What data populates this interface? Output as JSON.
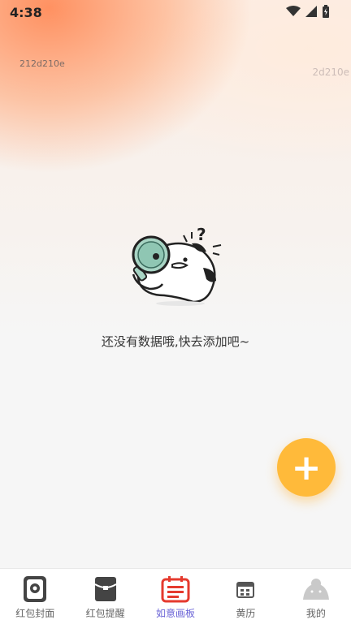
{
  "status_bar": {
    "time": "4:38",
    "icons": [
      "wifi-icon",
      "signal-icon",
      "battery-icon"
    ]
  },
  "watermarks": {
    "left": "212d210e",
    "right": "2d210e"
  },
  "empty_state": {
    "message": "还没有数据哦,快去添加吧~",
    "illustration": "magnifier-character"
  },
  "fab": {
    "label": "+",
    "color": "#ffba3a"
  },
  "tabbar": {
    "active_color": "#6a63d6",
    "items": [
      {
        "label": "红包封面",
        "icon": "cover-icon"
      },
      {
        "label": "红包提醒",
        "icon": "envelope-icon"
      },
      {
        "label": "如意画板",
        "icon": "board-icon",
        "active": true
      },
      {
        "label": "黄历",
        "icon": "calendar-icon"
      },
      {
        "label": "我的",
        "icon": "profile-icon"
      }
    ]
  }
}
